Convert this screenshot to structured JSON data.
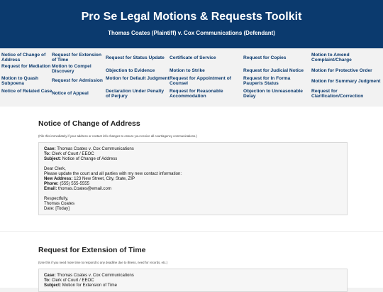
{
  "header": {
    "title": "Pro Se Legal Motions & Requests Toolkit",
    "subtitle": "Thomas Coates (Plaintiff) v. Cox Communications (Defendant)"
  },
  "nav": {
    "col1": [
      "Notice of Change of Address",
      "Request for Mediation",
      "Motion to Quash Subpoena",
      "Notice of Related Case"
    ],
    "col2": [
      "Request for Extension of Time",
      "Motion to Compel Discovery",
      "Request for Admission",
      "Notice of Appeal"
    ],
    "col3": [
      "Request for Status Update",
      "Objection to Evidence",
      "Motion for Default Judgment",
      "Declaration Under Penalty of Perjury"
    ],
    "col4": [
      "Certificate of Service",
      "Motion to Strike",
      "Request for Appointment of Counsel",
      "Request for Reasonable Accommodation"
    ],
    "col5": [
      "Request for Copies",
      "Request for Judicial Notice",
      "Request for In Forma Pauperis Status",
      "Objection to Unreasonable Delay"
    ],
    "col6": [
      "Motion to Amend Complaint/Charge",
      "Motion for Protective Order",
      "Motion for Summary Judgment",
      "Request for Clarification/Correction"
    ]
  },
  "sections": [
    {
      "title": "Notice of Change of Address",
      "note": "(File this immediately if your address or contact info changes to ensure you receive all court/agency communications.)",
      "case_label": "Case:",
      "case_value": "Thomas Coates v. Cox Communications",
      "to_label": "To:",
      "to_value": "Clerk of Court / EEOC",
      "subject_label": "Subject:",
      "subject_value": "Notice of Change of Address",
      "greeting": "Dear Clerk,",
      "body": "Please update the court and all parties with my new contact information:",
      "address_label": "New Address:",
      "address_value": "123 New Street, City, State, ZIP",
      "phone_label": "Phone:",
      "phone_value": "(555) 555-5555",
      "email_label": "Email:",
      "email_value": "thomas.Coates@email.com",
      "closing": "Respectfully,",
      "signature": "Thomas Coates",
      "date": "Date: [Today]"
    },
    {
      "title": "Request for Extension of Time",
      "note": "(Use this if you need more time to respond to any deadline due to illness, need for records, etc.)",
      "case_label": "Case:",
      "case_value": "Thomas Coates v. Cox Communications",
      "to_label": "To:",
      "to_value": "Clerk of Court / EEOC",
      "subject_label": "Subject:",
      "subject_value": "Motion for Extension of Time"
    }
  ]
}
